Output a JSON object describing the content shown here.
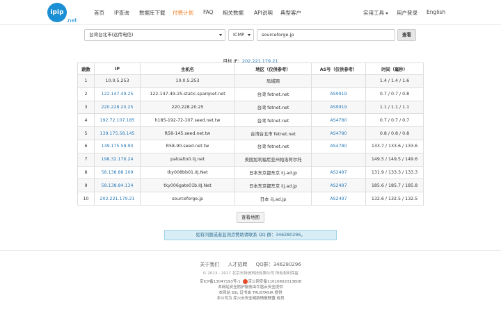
{
  "header": {
    "logo_text": "ipip",
    "logo_suffix": ".net",
    "nav": [
      "首页",
      "IP查询",
      "数据库下载",
      "付费计划",
      "FAQ",
      "相关数据",
      "API说明",
      "典型客户"
    ],
    "right_nav": [
      "实用工具",
      "用户登录",
      "English"
    ],
    "active_color": "#f07a1a"
  },
  "query": {
    "node": "台湾台北市(远传电信)",
    "protocol": "ICMP",
    "host": "sourceforge.jp",
    "button": "查看"
  },
  "target": {
    "label": "目标 IP：",
    "ip": "202.221.179.21"
  },
  "table": {
    "headers": [
      "跳数",
      "IP",
      "主机名",
      "地区（仅供参考）",
      "AS号（仅供参考）",
      "时间（毫秒）"
    ],
    "rows": [
      [
        "1",
        "10.0.5.253",
        "10.0.5.253",
        "局域网",
        "",
        "1.4 / 1.4 / 1.6"
      ],
      [
        "2",
        "122.147.49.25",
        "122-147-49-25.static.sparqnet.net",
        "台湾 fetnet.net",
        "AS9919",
        "0.7 / 0.7 / 0.8"
      ],
      [
        "3",
        "220.228.20.25",
        "220.228.20.25",
        "台湾 fetnet.net",
        "AS9919",
        "1.1 / 1.1 / 1.1"
      ],
      [
        "4",
        "192.72.107.185",
        "h185-192-72-107.seed.net.tw",
        "台湾 fetnet.net",
        "AS4780",
        "0.7 / 0.7 / 0.7"
      ],
      [
        "5",
        "139.175.58.145",
        "R58-145.seed.net.tw",
        "台湾台北市 fetnet.net",
        "AS4780",
        "0.8 / 0.8 / 0.8"
      ],
      [
        "6",
        "139.175.58.90",
        "R58-90.seed.net.tw",
        "台湾 fetnet.net",
        "AS4780",
        "133.7 / 133.6 / 133.6"
      ],
      [
        "7",
        "198.32.176.24",
        "paloalto0.iij.net",
        "美国加利福尼亚州帕洛阿尔托",
        "",
        "149.5 / 149.5 / 149.6"
      ],
      [
        "8",
        "58.138.88.109",
        "tky008bb01.IIJ.Net",
        "日本东京都东京 iij.ad.jp",
        "AS2497",
        "131.9 / 133.3 / 133.3"
      ],
      [
        "9",
        "58.138.84.134",
        "tky006gate01b.IIJ.Net",
        "日本东京都东京 iij.ad.jp",
        "AS2497",
        "185.6 / 185.7 / 185.8"
      ],
      [
        "10",
        "202.221.179.21",
        "sourceforge.jp",
        "日本 iij.ad.jp",
        "AS2497",
        "132.6 / 132.5 / 132.5"
      ]
    ]
  },
  "map_button": "查看地图",
  "notice": "如有问题或者监测点赞助请联系 QQ 群：346280296。",
  "footer": {
    "links": [
      "关于我们",
      "人才招聘",
      "QQ群：346280296"
    ],
    "copyright": "© 2013 - 2017 北京天特信科技有限公司 所有权利保留",
    "icp": "京ICP备13047193号-1",
    "police": "京公网安备11010802013608",
    "lines": [
      "本网站安全防护服务由牛盾云安全提供",
      "本网站 SSL 证书由 TRUSTASIA 提供",
      "本公司为 库火云安全威胁情报联盟 成员"
    ]
  }
}
